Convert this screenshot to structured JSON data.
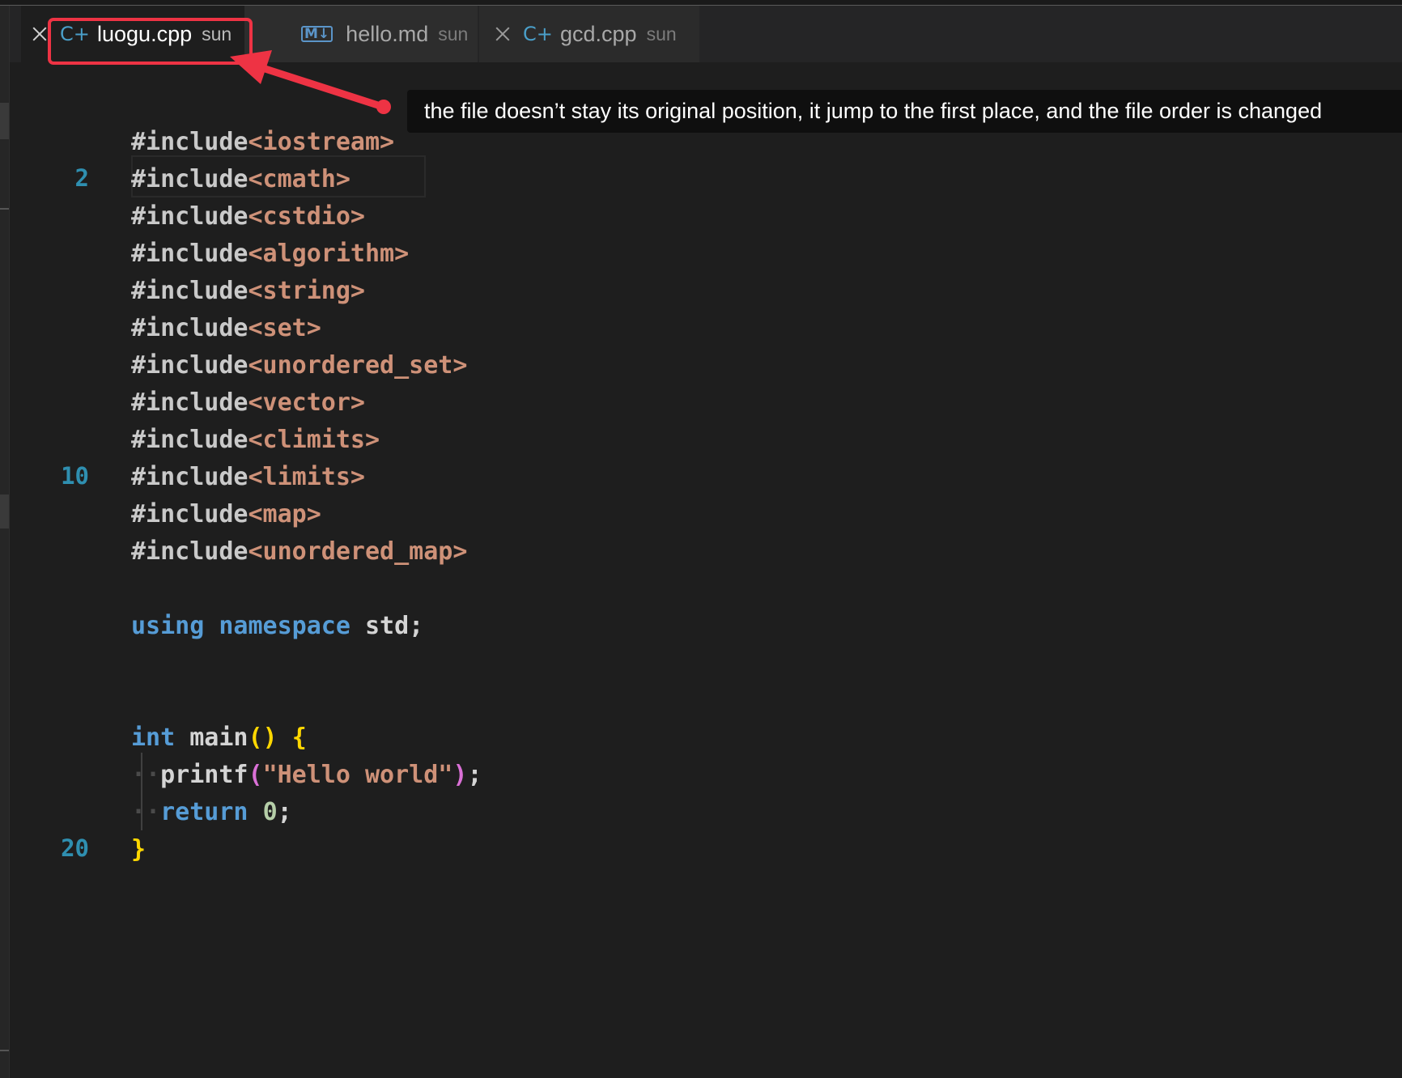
{
  "tabs": [
    {
      "name": "luogu.cpp",
      "owner": "sun",
      "icon": "cpp-icon",
      "active": true
    },
    {
      "name": "hello.md",
      "owner": "sun",
      "icon": "markdown-icon",
      "active": false
    },
    {
      "name": "gcd.cpp",
      "owner": "sun",
      "icon": "cpp-icon",
      "active": false
    }
  ],
  "icons": {
    "cpp": "C+",
    "markdown": "M↓"
  },
  "line_numbers": {
    "l2": "2",
    "l10": "10",
    "l20": "20"
  },
  "code": {
    "include": "#include",
    "lines": [
      "<iostream>",
      "<cmath>",
      "<cstdio>",
      "<algorithm>",
      "<string>",
      "<set>",
      "<unordered_set>",
      "<vector>",
      "<climits>",
      "<limits>",
      "<map>",
      "<unordered_map>"
    ],
    "using": "using",
    "namespace": "namespace",
    "std": "std;",
    "int": "int",
    "main": "main",
    "paren": "()",
    "brace_open": "{",
    "brace_close": "}",
    "indent": "··",
    "printf": "printf",
    "printf_open": "(",
    "printf_arg": "\"Hello world\"",
    "printf_close": ")",
    "semicolon": ";",
    "return": "return",
    "zero": "0"
  },
  "annotation": {
    "text": "the file doesn’t stay its original position, it jump to the first place, and the file order is changed",
    "color": "#ee3344"
  },
  "colors": {
    "background": "#1e1e1e",
    "keyword": "#569cd6",
    "string": "#ce9178",
    "line_number": "#2f8fb0",
    "bracket": "#ffd700"
  }
}
